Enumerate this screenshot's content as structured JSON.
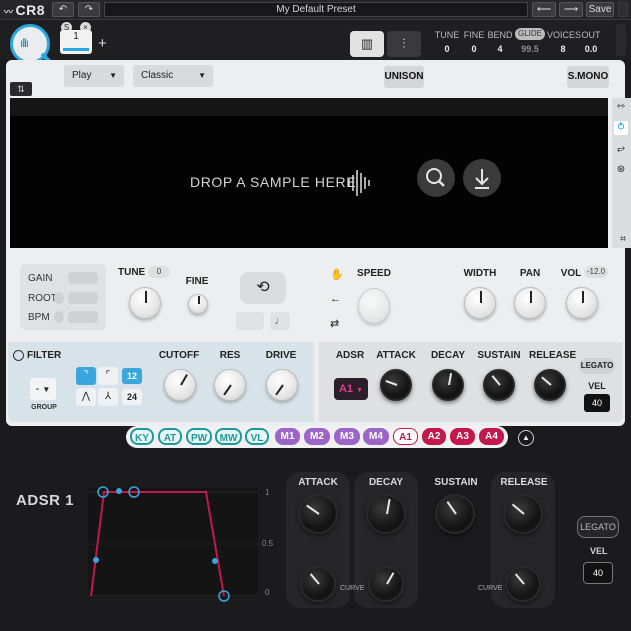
{
  "app": {
    "logo": "CR8",
    "preset_name": "My Default Preset",
    "save_label": "Save"
  },
  "slot": {
    "label": "1"
  },
  "header": {
    "labels": [
      "TUNE",
      "FINE",
      "BEND",
      "GLIDE",
      "VOICES",
      "OUT"
    ],
    "values": [
      "0",
      "0",
      "4",
      "99.5",
      "8",
      "0.0"
    ]
  },
  "toolbar": {
    "play_mode": "Play",
    "algorithm": "Classic",
    "unison_label": "UNISON",
    "smono_label": "S.MONO"
  },
  "sample": {
    "drop_text": "DROP A SAMPLE HERE"
  },
  "source": {
    "gain_label": "GAIN",
    "root_label": "ROOT",
    "bpm_label": "BPM",
    "tune_label": "TUNE",
    "tune_value": "0",
    "fine_label": "FINE",
    "speed_label": "SPEED",
    "width_label": "WIDTH",
    "pan_label": "PAN",
    "vol_label": "VOL",
    "vol_value": "-12.0"
  },
  "filter": {
    "label": "FILTER",
    "group_value": "-",
    "group_label": "GROUP",
    "slopes": [
      "12",
      "24"
    ],
    "cutoff_label": "CUTOFF",
    "res_label": "RES",
    "drive_label": "DRIVE"
  },
  "adsr_strip": {
    "label": "ADSR",
    "selected": "A1",
    "attack_label": "ATTACK",
    "decay_label": "DECAY",
    "sustain_label": "SUSTAIN",
    "release_label": "RELEASE",
    "legato_label": "LEGATO",
    "vel_label": "VEL",
    "vel_value": "40"
  },
  "mod_tabs": [
    "KY",
    "AT",
    "PW",
    "MW",
    "VL",
    "M1",
    "M2",
    "M3",
    "M4",
    "A1",
    "A2",
    "A3",
    "A4"
  ],
  "adsr_panel": {
    "title": "ADSR 1",
    "axis": [
      "1",
      "0.5",
      "0"
    ],
    "attack_label": "ATTACK",
    "decay_label": "DECAY",
    "sustain_label": "SUSTAIN",
    "release_label": "RELEASE",
    "curve_label": "CURVE",
    "legato_label": "LEGATO",
    "vel_label": "VEL",
    "vel_value": "40"
  },
  "colors": {
    "accent": "#2aa7e0",
    "env": "#c2184b",
    "mod": "#9c66c8",
    "ky": "#1e9a9a"
  }
}
